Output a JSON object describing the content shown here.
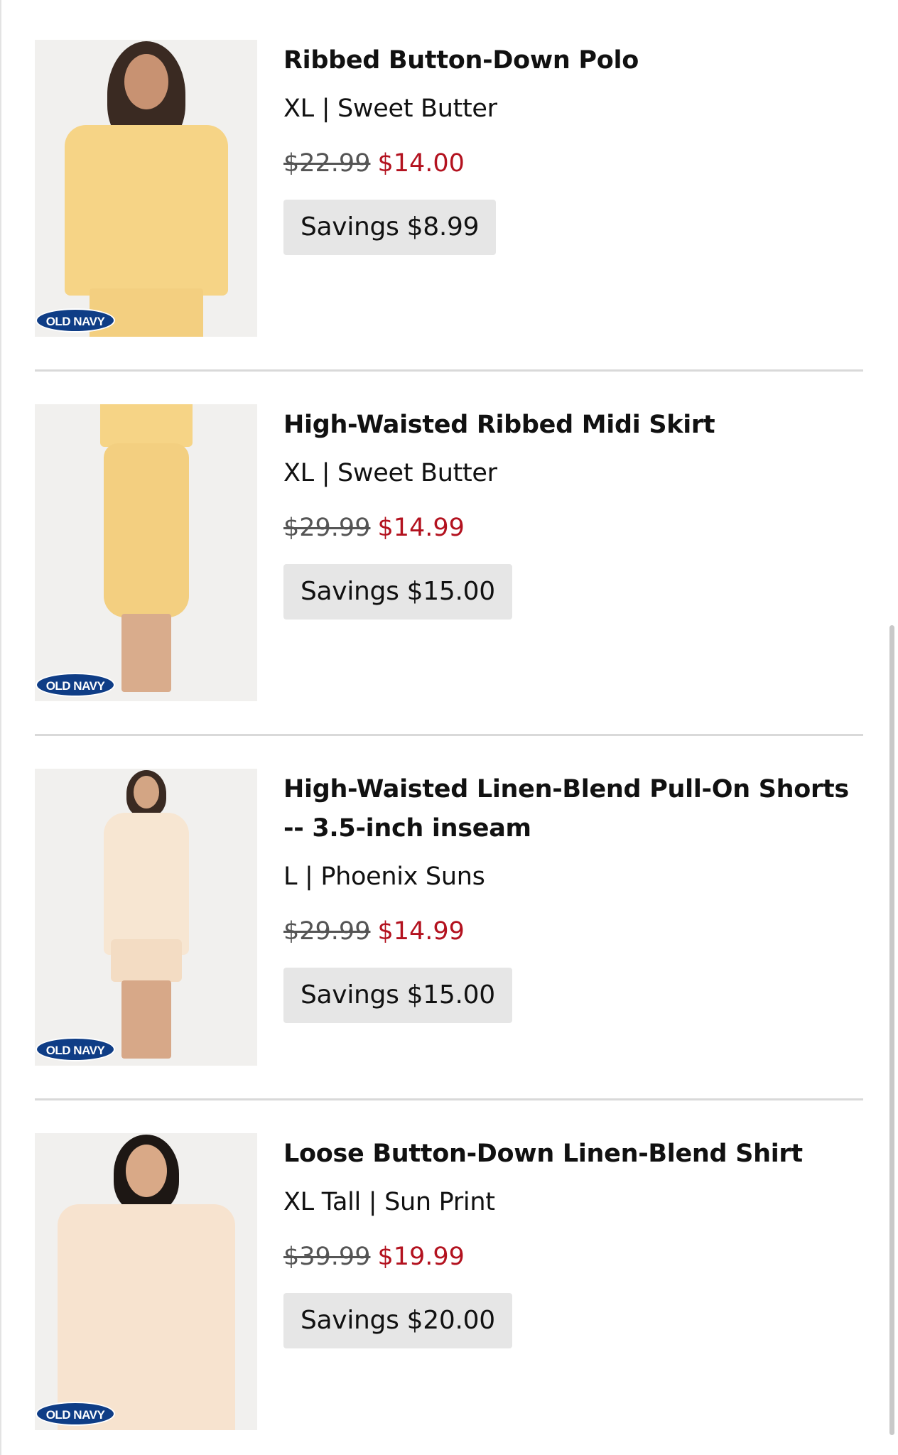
{
  "brand_logo_text": "OLD NAVY",
  "savings_prefix": "Savings",
  "colors": {
    "sale_price": "#b3121f",
    "original_price": "#555555",
    "savings_bg": "#e6e6e6",
    "badge_bg": "#0f3d86"
  },
  "items": [
    {
      "title": "Ribbed Button-Down Polo",
      "variant": "XL | Sweet Butter",
      "original_price": "$22.99",
      "sale_price": "$14.00",
      "savings": "Savings $8.99"
    },
    {
      "title": "High-Waisted Ribbed Midi Skirt",
      "variant": "XL | Sweet Butter",
      "original_price": "$29.99",
      "sale_price": "$14.99",
      "savings": "Savings $15.00"
    },
    {
      "title": "High-Waisted Linen-Blend Pull-On Shorts -- 3.5-inch inseam",
      "variant": "L | Phoenix Suns",
      "original_price": "$29.99",
      "sale_price": "$14.99",
      "savings": "Savings $15.00"
    },
    {
      "title": "Loose Button-Down Linen-Blend Shirt",
      "variant": "XL Tall | Sun Print",
      "original_price": "$39.99",
      "sale_price": "$19.99",
      "savings": "Savings $20.00"
    }
  ]
}
